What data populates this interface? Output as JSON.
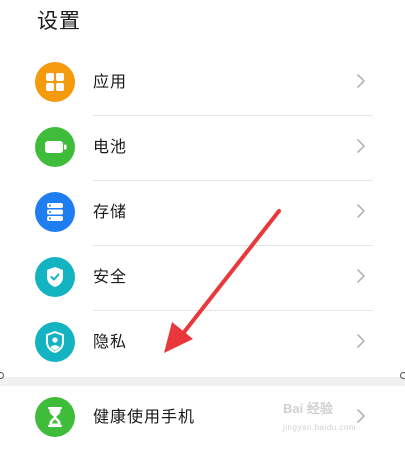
{
  "header": {
    "title": "设置"
  },
  "settings": {
    "items": [
      {
        "label": "应用",
        "icon": "apps-icon",
        "color": "#f59a0c"
      },
      {
        "label": "电池",
        "icon": "battery-icon",
        "color": "#3fbd3a"
      },
      {
        "label": "存储",
        "icon": "storage-icon",
        "color": "#1e7ef0"
      },
      {
        "label": "安全",
        "icon": "shield-check-icon",
        "color": "#14b3c2"
      },
      {
        "label": "隐私",
        "icon": "privacy-shield-icon",
        "color": "#14b3c2"
      }
    ],
    "bottom_item": {
      "label": "健康使用手机",
      "icon": "hourglass-icon",
      "color": "#3fbd3a"
    }
  },
  "annotation": {
    "arrow_color": "#e8383b"
  },
  "watermark": {
    "text": "Bai 经验",
    "sub": "jingyan.baidu.com"
  }
}
